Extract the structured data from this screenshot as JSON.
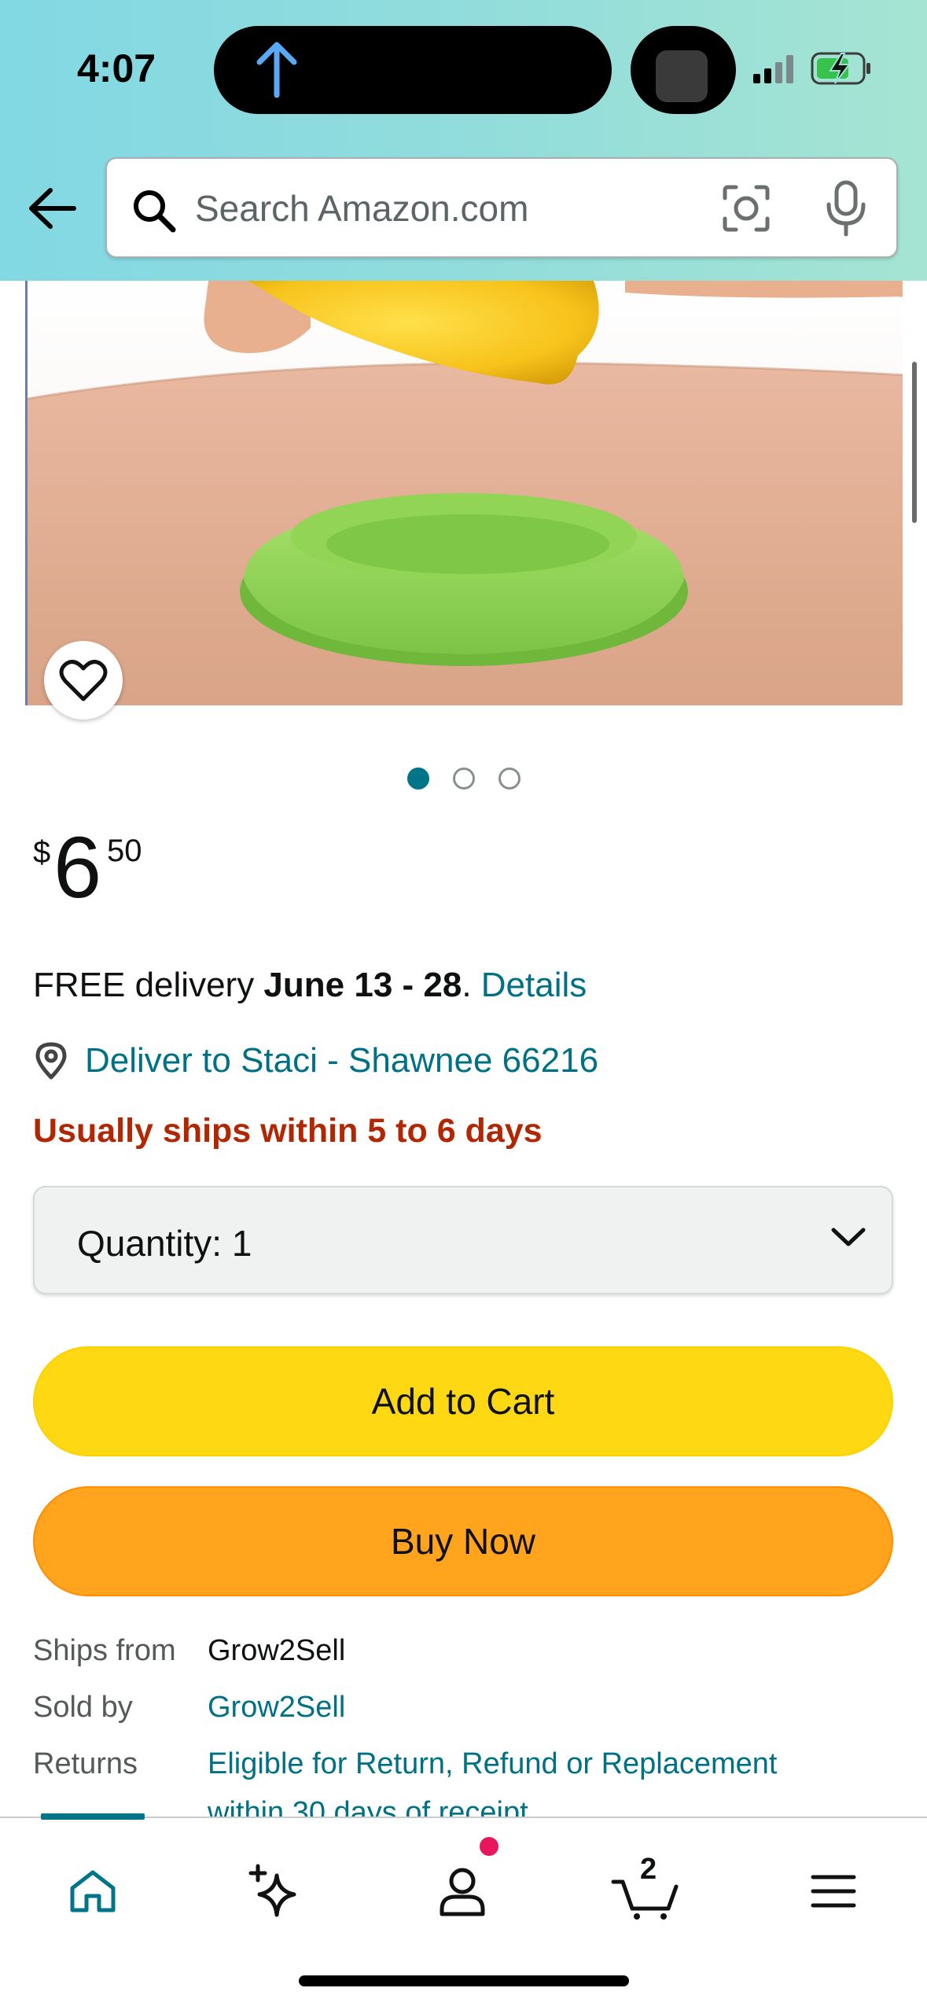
{
  "status_bar": {
    "time": "4:07"
  },
  "search": {
    "placeholder": "Search Amazon.com"
  },
  "carousel": {
    "pages": 3,
    "active_index": 0
  },
  "price": {
    "currency_symbol": "$",
    "whole": "6",
    "fraction": "50"
  },
  "delivery": {
    "prefix": "FREE delivery ",
    "dates": "June 13 - 28",
    "separator": ". ",
    "details_link": "Details"
  },
  "deliver_to": "Deliver to Staci - Shawnee 66216",
  "shipping_notice": "Usually ships within 5 to 6 days",
  "quantity": {
    "label": "Quantity:",
    "value": "1"
  },
  "buttons": {
    "add_to_cart": "Add to Cart",
    "buy_now": "Buy Now"
  },
  "seller_info": {
    "ships_from_label": "Ships from",
    "ships_from_value": "Grow2Sell",
    "sold_by_label": "Sold by",
    "sold_by_value": "Grow2Sell",
    "returns_label": "Returns",
    "returns_line1": "Eligible for Return, Refund or Replacement",
    "returns_line2": "within 30 days of receipt"
  },
  "bottom_nav": {
    "cart_count": "2",
    "active": "home"
  },
  "colors": {
    "link": "#007185",
    "alert": "#B12704",
    "cart_button": "#FFD814",
    "buy_button": "#FFA41C"
  },
  "icons": [
    "back-arrow-icon",
    "search-icon",
    "camera-lens-icon",
    "microphone-icon",
    "heart-icon",
    "location-pin-icon",
    "chevron-down-icon",
    "home-icon",
    "sparkle-icon",
    "account-icon",
    "cart-icon",
    "menu-icon"
  ]
}
